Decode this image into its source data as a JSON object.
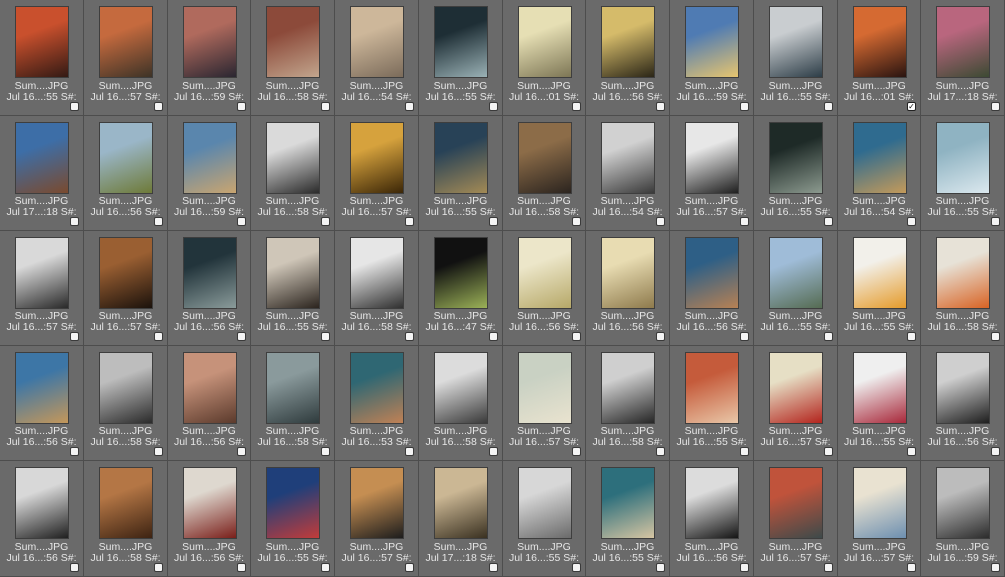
{
  "browser": {
    "items": [
      {
        "name": "Sum....JPG",
        "date": "Jul 16...:55 S#:",
        "checked": false,
        "colors": [
          "#c9502d",
          "#331a14"
        ],
        "icon": "photo-silhouette-sunset"
      },
      {
        "name": "Sum....JPG",
        "date": "Jul 16...:57 S#:",
        "checked": false,
        "colors": [
          "#c56a3e",
          "#3d3327"
        ],
        "icon": "photo-sunset-field"
      },
      {
        "name": "Sum....JPG",
        "date": "Jul 16...:59 S#:",
        "checked": false,
        "colors": [
          "#b06a5d",
          "#2a2631"
        ],
        "icon": "photo-sunset-figure"
      },
      {
        "name": "Sum....JPG",
        "date": "Jul 16...:58 S#:",
        "checked": false,
        "colors": [
          "#8c4a3a",
          "#c2a58d"
        ],
        "icon": "photo-rocky-beach"
      },
      {
        "name": "Sum....JPG",
        "date": "Jul 16...:54 S#:",
        "checked": false,
        "colors": [
          "#cdb79a",
          "#7b6b5a"
        ],
        "icon": "photo-shells"
      },
      {
        "name": "Sum....JPG",
        "date": "Jul 16...:55 S#:",
        "checked": false,
        "colors": [
          "#1e2e35",
          "#9ab1b5"
        ],
        "icon": "photo-swimmer"
      },
      {
        "name": "Sum....JPG",
        "date": "Jul 16...:01 S#:",
        "checked": false,
        "colors": [
          "#e6dfb4",
          "#7d7655"
        ],
        "icon": "photo-sunglasses"
      },
      {
        "name": "Sum....JPG",
        "date": "Jul 16...:56 S#:",
        "checked": false,
        "colors": [
          "#d5bb6a",
          "#2b2617"
        ],
        "icon": "photo-sunglasses-shadow"
      },
      {
        "name": "Sum....JPG",
        "date": "Jul 16...:59 S#:",
        "checked": false,
        "colors": [
          "#4f7bb3",
          "#e7c56f"
        ],
        "icon": "photo-fabric"
      },
      {
        "name": "Sum....JPG",
        "date": "Jul 16...:55 S#:",
        "checked": false,
        "colors": [
          "#c9cdd0",
          "#2d3d47"
        ],
        "icon": "photo-lake-figure"
      },
      {
        "name": "Sum....JPG",
        "date": "Jul 16...:01 S#:",
        "checked": true,
        "colors": [
          "#d56a32",
          "#2a1410"
        ],
        "icon": "photo-riders"
      },
      {
        "name": "Sum....JPG",
        "date": "Jul 17...:18 S#:",
        "checked": false,
        "colors": [
          "#b9667e",
          "#3c4a33"
        ],
        "icon": "photo-agave"
      },
      {
        "name": "Sum....JPG",
        "date": "Jul 17...:18 S#:",
        "checked": false,
        "colors": [
          "#3d6ea7",
          "#7a4a2e"
        ],
        "icon": "photo-aloe-flower"
      },
      {
        "name": "Sum....JPG",
        "date": "Jul 16...:56 S#:",
        "checked": false,
        "colors": [
          "#9ab6c8",
          "#6e7a38"
        ],
        "icon": "photo-cactus-field"
      },
      {
        "name": "Sum....JPG",
        "date": "Jul 16...:59 S#:",
        "checked": false,
        "colors": [
          "#5a86ad",
          "#c9a570"
        ],
        "icon": "photo-cactus-bloom"
      },
      {
        "name": "Sum....JPG",
        "date": "Jul 16...:58 S#:",
        "checked": false,
        "colors": [
          "#dadada",
          "#2b2b2b"
        ],
        "icon": "photo-cowboy-portrait"
      },
      {
        "name": "Sum....JPG",
        "date": "Jul 16...:57 S#:",
        "checked": false,
        "colors": [
          "#d6a23d",
          "#3b2607"
        ],
        "icon": "photo-citrus"
      },
      {
        "name": "Sum....JPG",
        "date": "Jul 16...:55 S#:",
        "checked": false,
        "colors": [
          "#284257",
          "#a38a55"
        ],
        "icon": "photo-fish-water"
      },
      {
        "name": "Sum....JPG",
        "date": "Jul 16...:58 S#:",
        "checked": false,
        "colors": [
          "#8c6c48",
          "#2b241f"
        ],
        "icon": "photo-oysters"
      },
      {
        "name": "Sum....JPG",
        "date": "Jul 16...:54 S#:",
        "checked": false,
        "colors": [
          "#d1d1d1",
          "#3a3a3a"
        ],
        "icon": "photo-ship-rail"
      },
      {
        "name": "Sum....JPG",
        "date": "Jul 16...:57 S#:",
        "checked": false,
        "colors": [
          "#e7e7e7",
          "#1f1f1f"
        ],
        "icon": "photo-woman-bw"
      },
      {
        "name": "Sum....JPG",
        "date": "Jul 16...:55 S#:",
        "checked": false,
        "colors": [
          "#1e2a27",
          "#8c9a8f"
        ],
        "icon": "photo-sea-sparkle"
      },
      {
        "name": "Sum....JPG",
        "date": "Jul 16...:54 S#:",
        "checked": false,
        "colors": [
          "#2f6b8f",
          "#c49a5a"
        ],
        "icon": "photo-wet-hair"
      },
      {
        "name": "Sum....JPG",
        "date": "Jul 16...:55 S#:",
        "checked": false,
        "colors": [
          "#8fb3c2",
          "#dbe8ee"
        ],
        "icon": "photo-water-glass"
      },
      {
        "name": "Sum....JPG",
        "date": "Jul 16...:57 S#:",
        "checked": false,
        "colors": [
          "#d9d9d9",
          "#2a2a2a"
        ],
        "icon": "photo-drink-bw"
      },
      {
        "name": "Sum....JPG",
        "date": "Jul 16...:57 S#:",
        "checked": false,
        "colors": [
          "#9a5f32",
          "#1b120c"
        ],
        "icon": "photo-skin-shoulder"
      },
      {
        "name": "Sum....JPG",
        "date": "Jul 16...:56 S#:",
        "checked": false,
        "colors": [
          "#22343b",
          "#8a9b9a"
        ],
        "icon": "photo-pool-edge"
      },
      {
        "name": "Sum....JPG",
        "date": "Jul 16...:55 S#:",
        "checked": false,
        "colors": [
          "#cfc6b8",
          "#2b241e"
        ],
        "icon": "photo-wet-portrait"
      },
      {
        "name": "Sum....JPG",
        "date": "Jul 16...:58 S#:",
        "checked": false,
        "colors": [
          "#e6e6e6",
          "#303030"
        ],
        "icon": "photo-swim-cap"
      },
      {
        "name": "Sum....JPG",
        "date": "Jul 16...:47 S#:",
        "checked": false,
        "colors": [
          "#111111",
          "#9bb157"
        ],
        "icon": "photo-limes-box"
      },
      {
        "name": "Sum....JPG",
        "date": "Jul 16...:56 S#:",
        "checked": false,
        "colors": [
          "#ece6c9",
          "#b6a868"
        ],
        "icon": "photo-perfume"
      },
      {
        "name": "Sum....JPG",
        "date": "Jul 16...:56 S#:",
        "checked": false,
        "colors": [
          "#e8dcb2",
          "#8e7a4c"
        ],
        "icon": "photo-fabric-folds"
      },
      {
        "name": "Sum....JPG",
        "date": "Jul 16...:56 S#:",
        "checked": false,
        "colors": [
          "#2e5f86",
          "#b78154"
        ],
        "icon": "photo-hat-woman"
      },
      {
        "name": "Sum....JPG",
        "date": "Jul 16...:55 S#:",
        "checked": false,
        "colors": [
          "#9fbcd8",
          "#556b52"
        ],
        "icon": "photo-agave-mountain"
      },
      {
        "name": "Sum....JPG",
        "date": "Jul 16...:55 S#:",
        "checked": false,
        "colors": [
          "#f2f0ea",
          "#e59b2b"
        ],
        "icon": "photo-oranges-stack"
      },
      {
        "name": "Sum....JPG",
        "date": "Jul 16...:58 S#:",
        "checked": false,
        "colors": [
          "#e7e2d7",
          "#d86324"
        ],
        "icon": "photo-oranges-bag"
      },
      {
        "name": "Sum....JPG",
        "date": "Jul 16...:56 S#:",
        "checked": false,
        "colors": [
          "#3d76a6",
          "#c4975a"
        ],
        "icon": "photo-woman-sky"
      },
      {
        "name": "Sum....JPG",
        "date": "Jul 16...:58 S#:",
        "checked": false,
        "colors": [
          "#bdbdbd",
          "#2b2b2b"
        ],
        "icon": "photo-woman-hat-bw"
      },
      {
        "name": "Sum....JPG",
        "date": "Jul 16...:56 S#:",
        "checked": false,
        "colors": [
          "#c6927a",
          "#5b3a2c"
        ],
        "icon": "photo-face-closeup"
      },
      {
        "name": "Sum....JPG",
        "date": "Jul 16...:58 S#:",
        "checked": false,
        "colors": [
          "#8a9a9c",
          "#2f3b3d"
        ],
        "icon": "photo-waves-beach"
      },
      {
        "name": "Sum....JPG",
        "date": "Jul 16...:53 S#:",
        "checked": false,
        "colors": [
          "#2f6773",
          "#c08155"
        ],
        "icon": "photo-runner"
      },
      {
        "name": "Sum....JPG",
        "date": "Jul 16...:58 S#:",
        "checked": false,
        "colors": [
          "#dcdcdc",
          "#3a3a3a"
        ],
        "icon": "photo-palm-woman"
      },
      {
        "name": "Sum....JPG",
        "date": "Jul 16...:57 S#:",
        "checked": false,
        "colors": [
          "#c9d1c3",
          "#e9e3cf"
        ],
        "icon": "photo-shuttlecock"
      },
      {
        "name": "Sum....JPG",
        "date": "Jul 16...:58 S#:",
        "checked": false,
        "colors": [
          "#cfcfcf",
          "#262626"
        ],
        "icon": "photo-bicycle"
      },
      {
        "name": "Sum....JPG",
        "date": "Jul 16...:55 S#:",
        "checked": false,
        "colors": [
          "#c55b3b",
          "#e9c7a8"
        ],
        "icon": "photo-striped-hat"
      },
      {
        "name": "Sum....JPG",
        "date": "Jul 16...:57 S#:",
        "checked": false,
        "colors": [
          "#e6dfc5",
          "#b3241d"
        ],
        "icon": "photo-lobster"
      },
      {
        "name": "Sum....JPG",
        "date": "Jul 16...:55 S#:",
        "checked": false,
        "colors": [
          "#efefef",
          "#a8283a"
        ],
        "icon": "photo-shrimp-plate"
      },
      {
        "name": "Sum....JPG",
        "date": "Jul 16...:56 S#:",
        "checked": false,
        "colors": [
          "#cfcfcf",
          "#1e1e1e"
        ],
        "icon": "photo-portrait-bw"
      },
      {
        "name": "Sum....JPG",
        "date": "Jul 16...:56 S#:",
        "checked": false,
        "colors": [
          "#d8d8d8",
          "#202020"
        ],
        "icon": "photo-swimsuit-bw"
      },
      {
        "name": "Sum....JPG",
        "date": "Jul 16...:58 S#:",
        "checked": false,
        "colors": [
          "#b47645",
          "#3d2312"
        ],
        "icon": "photo-face-sparkle"
      },
      {
        "name": "Sum....JPG",
        "date": "Jul 16...:56 S#:",
        "checked": false,
        "colors": [
          "#ded8cf",
          "#7a1f1a"
        ],
        "icon": "photo-fruit-bowl"
      },
      {
        "name": "Sum....JPG",
        "date": "Jul 16...:55 S#:",
        "checked": false,
        "colors": [
          "#1f3f7a",
          "#c23c3a"
        ],
        "icon": "photo-cherries-table"
      },
      {
        "name": "Sum....JPG",
        "date": "Jul 16...:57 S#:",
        "checked": false,
        "colors": [
          "#c58e52",
          "#1d1d1d"
        ],
        "icon": "photo-sunglasses-woman"
      },
      {
        "name": "Sum....JPG",
        "date": "Jul 17...:18 S#:",
        "checked": false,
        "colors": [
          "#cbb794",
          "#3a3121"
        ],
        "icon": "photo-desert-haze"
      },
      {
        "name": "Sum....JPG",
        "date": "Jul 16...:55 S#:",
        "checked": false,
        "colors": [
          "#d7d7d7",
          "#6a6a6a"
        ],
        "icon": "photo-surfboard-beach"
      },
      {
        "name": "Sum....JPG",
        "date": "Jul 16...:55 S#:",
        "checked": false,
        "colors": [
          "#2d6f7c",
          "#d6c5a2"
        ],
        "icon": "photo-wave"
      },
      {
        "name": "Sum....JPG",
        "date": "Jul 16...:56 S#:",
        "checked": false,
        "colors": [
          "#dcdcdc",
          "#151515"
        ],
        "icon": "photo-surfer-cliff"
      },
      {
        "name": "Sum....JPG",
        "date": "Jul 16...:57 S#:",
        "checked": false,
        "colors": [
          "#c0533b",
          "#3d4a4a"
        ],
        "icon": "photo-sunset-sea"
      },
      {
        "name": "Sum....JPG",
        "date": "Jul 16...:57 S#:",
        "checked": false,
        "colors": [
          "#e9e2d1",
          "#6d8fb0"
        ],
        "icon": "photo-sail"
      },
      {
        "name": "Sum....JPG",
        "date": "Jul 16...:59 S#:",
        "checked": false,
        "colors": [
          "#bcbcbc",
          "#2c2c2c"
        ],
        "icon": "photo-surfer-bw"
      }
    ]
  }
}
